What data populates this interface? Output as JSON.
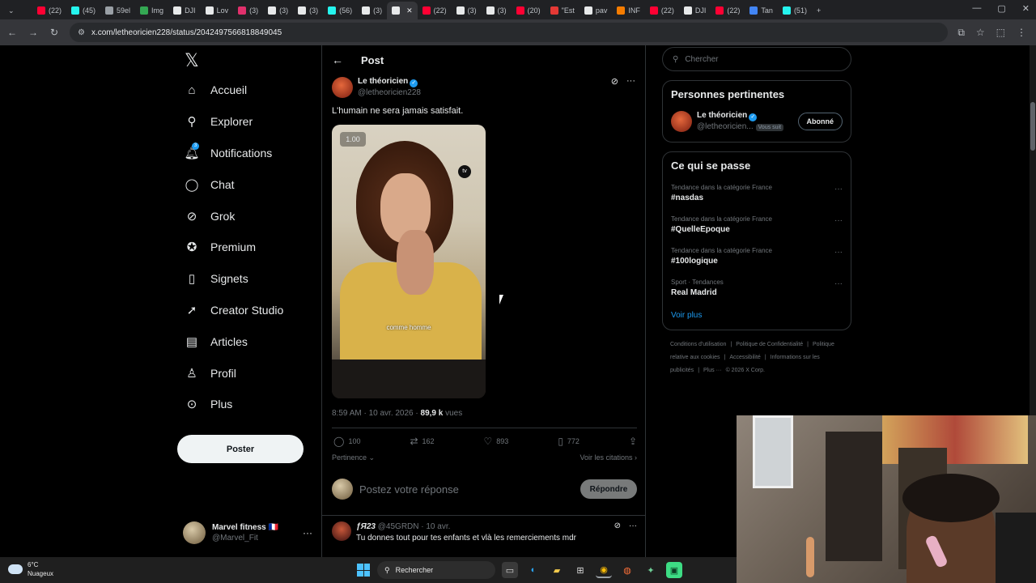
{
  "browser": {
    "tabs": [
      {
        "label": "(22)",
        "color": "#ff0033"
      },
      {
        "label": "(45)",
        "color": "#25f4ee"
      },
      {
        "label": "59el",
        "color": "#9aa0a6"
      },
      {
        "label": "Img",
        "color": "#34a853"
      },
      {
        "label": "DJI",
        "color": "#e7e9ea"
      },
      {
        "label": "Lov",
        "color": "#e7e9ea"
      },
      {
        "label": "(3)",
        "color": "#e1306c"
      },
      {
        "label": "(3)",
        "color": "#e7e9ea"
      },
      {
        "label": "(3)",
        "color": "#e7e9ea"
      },
      {
        "label": "(56)",
        "color": "#25f4ee"
      },
      {
        "label": "(3)",
        "color": "#e7e9ea"
      },
      {
        "label": "",
        "color": "#e7e9ea",
        "active": true
      },
      {
        "label": "(22)",
        "color": "#ff0033"
      },
      {
        "label": "(3)",
        "color": "#e7e9ea"
      },
      {
        "label": "(3)",
        "color": "#e7e9ea"
      },
      {
        "label": "(20)",
        "color": "#ff0033"
      },
      {
        "label": "\"Est",
        "color": "#e53935"
      },
      {
        "label": "pav",
        "color": "#e7e9ea"
      },
      {
        "label": "INF",
        "color": "#f57c00"
      },
      {
        "label": "(22)",
        "color": "#ff0033"
      },
      {
        "label": "DJI",
        "color": "#e7e9ea"
      },
      {
        "label": "(22)",
        "color": "#ff0033"
      },
      {
        "label": "Tan",
        "color": "#4285f4"
      },
      {
        "label": "(51)",
        "color": "#25f4ee"
      }
    ],
    "url": "x.com/letheoricien228/status/2042497566818849045"
  },
  "sidebar": {
    "logo": "𝕏",
    "items": [
      {
        "label": "Accueil",
        "icon": "⌂",
        "name": "home"
      },
      {
        "label": "Explorer",
        "icon": "⚲",
        "name": "explore"
      },
      {
        "label": "Notifications",
        "icon": "🔔︎",
        "name": "notifications",
        "badge": "3"
      },
      {
        "label": "Chat",
        "icon": "◯",
        "name": "chat"
      },
      {
        "label": "Grok",
        "icon": "⊘",
        "name": "grok"
      },
      {
        "label": "Premium",
        "icon": "✪",
        "name": "premium"
      },
      {
        "label": "Signets",
        "icon": "▯",
        "name": "bookmarks"
      },
      {
        "label": "Creator Studio",
        "icon": "➚",
        "name": "creator-studio"
      },
      {
        "label": "Articles",
        "icon": "▤",
        "name": "articles"
      },
      {
        "label": "Profil",
        "icon": "♙",
        "name": "profile"
      },
      {
        "label": "Plus",
        "icon": "⊙",
        "name": "more"
      }
    ],
    "post_button": "Poster",
    "account": {
      "name": "Marvel fitness 🇫🇷",
      "handle": "@Marvel_Fit"
    }
  },
  "main": {
    "header": "Post",
    "tweet": {
      "author": "Le théoricien",
      "handle": "@letheoricien228",
      "text": "L'humain ne sera jamais satisfait.",
      "video_speed": "1.00",
      "video_subtitle": "comme homme",
      "time": "8:59 AM · 10 avr. 2026 · ",
      "views": "89,9 k",
      "views_suffix": " vues",
      "replies": "100",
      "reposts": "162",
      "likes": "893",
      "bookmarks": "772"
    },
    "sort_label": "Pertinence ⌄",
    "quotes_link": "Voir les citations ›",
    "reply_placeholder": "Postez votre réponse",
    "reply_button": "Répondre",
    "reply": {
      "author": "ƒЯ23",
      "handle": "@45GRDN",
      "date": "· 10 avr.",
      "text": "Tu donnes tout pour tes enfants et vlà les remerciements mdr"
    }
  },
  "right": {
    "search_placeholder": "Chercher",
    "people_title": "Personnes pertinentes",
    "person": {
      "name": "Le théoricien",
      "handle": "@letheoricien...",
      "follows_you": "Vous suit",
      "button": "Abonné"
    },
    "trends_title": "Ce qui se passe",
    "trends": [
      {
        "context": "Tendance dans la catégorie France",
        "name": "#nasdas"
      },
      {
        "context": "Tendance dans la catégorie France",
        "name": "#QuelleEpoque"
      },
      {
        "context": "Tendance dans la catégorie France",
        "name": "#100logique"
      },
      {
        "context": "Sport · Tendances",
        "name": "Real Madrid"
      }
    ],
    "see_more": "Voir plus",
    "footer": [
      "Conditions d'utilisation",
      "|",
      "Politique de Confidentialité",
      "|",
      "Politique relative aux cookies",
      "|",
      "Accessibilité",
      "|",
      "Informations sur les publicités",
      "|",
      "Plus ···",
      "© 2026 X Corp."
    ]
  },
  "taskbar": {
    "temp": "6°C",
    "weather": "Nuageux",
    "search": "Rechercher"
  }
}
